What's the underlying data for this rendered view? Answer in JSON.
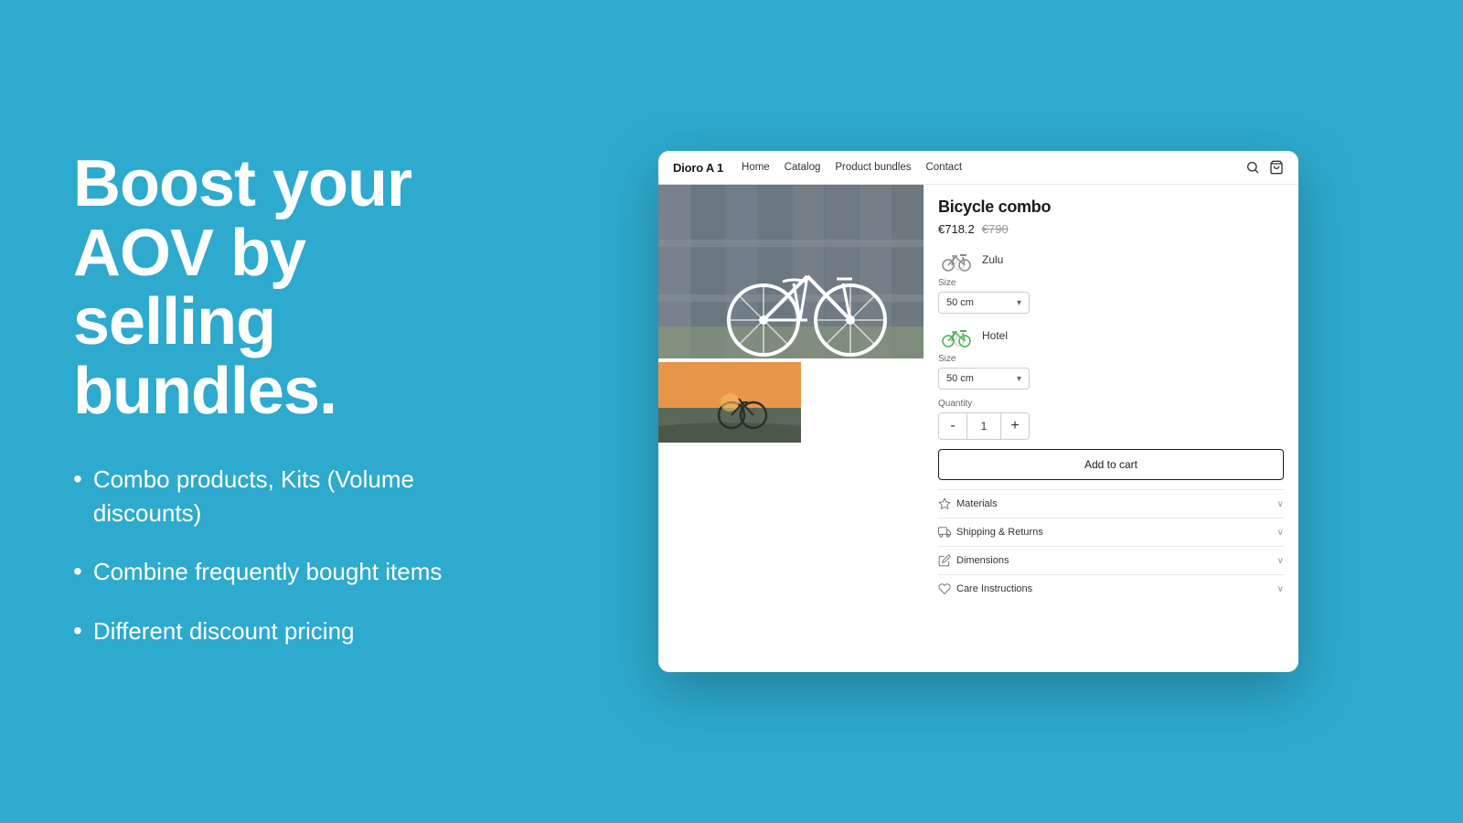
{
  "background_color": "#2DAACD",
  "left": {
    "headline": "Boost your AOV by selling bundles.",
    "bullets": [
      "Combo products, Kits (Volume discounts)",
      "Combine frequently bought items",
      "Different discount pricing"
    ]
  },
  "browser": {
    "store_name": "Dioro A 1",
    "nav_links": [
      "Home",
      "Catalog",
      "Product bundles",
      "Contact"
    ],
    "product": {
      "title": "Bicycle combo",
      "price_current": "€718.2",
      "price_original": "€790",
      "bikes": [
        {
          "name": "Zulu",
          "size_label": "Size",
          "size_value": "50 cm",
          "color": "gray"
        },
        {
          "name": "Hotel",
          "size_label": "Size",
          "size_value": "50 cm",
          "color": "green"
        }
      ],
      "quantity_label": "Quantity",
      "quantity_value": "1",
      "qty_minus": "-",
      "qty_plus": "+",
      "add_to_cart": "Add to cart",
      "accordions": [
        {
          "label": "Materials",
          "icon": "star-icon"
        },
        {
          "label": "Shipping & Returns",
          "icon": "truck-icon"
        },
        {
          "label": "Dimensions",
          "icon": "pencil-icon"
        },
        {
          "label": "Care Instructions",
          "icon": "heart-icon"
        }
      ]
    }
  }
}
